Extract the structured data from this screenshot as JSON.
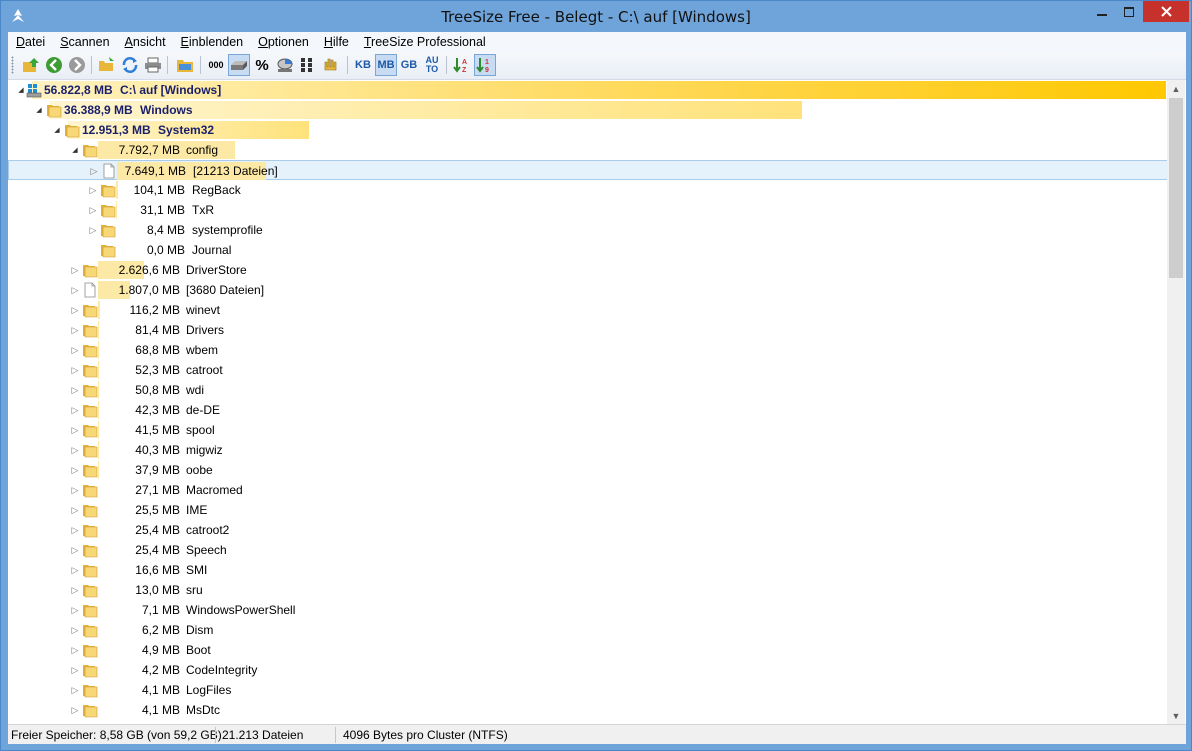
{
  "window": {
    "title": "TreeSize Free - Belegt - C:\\  auf  [Windows]"
  },
  "menu": [
    {
      "label": "Datei",
      "ul": "D",
      "rest": "atei"
    },
    {
      "label": "Scannen",
      "ul": "S",
      "rest": "cannen"
    },
    {
      "label": "Ansicht",
      "ul": "A",
      "rest": "nsicht"
    },
    {
      "label": "Einblenden",
      "ul": "E",
      "rest": "inblenden"
    },
    {
      "label": "Optionen",
      "ul": "O",
      "rest": "ptionen"
    },
    {
      "label": "Hilfe",
      "ul": "H",
      "rest": "ilfe"
    },
    {
      "label": "TreeSize Professional",
      "ul": "T",
      "rest": "reeSize Professional"
    }
  ],
  "toolbar": {
    "kb_label": "KB",
    "mb_label": "MB",
    "gb_label": "GB",
    "auto_label_top": "AU",
    "auto_label_bottom": "TO",
    "percent_label": "%",
    "count_label": "000",
    "active_unit": "MB"
  },
  "tree": [
    {
      "level": 0,
      "size": "56.822,8 MB",
      "name": "C:\\  auf  [Windows]",
      "icon": "drive-icon",
      "expanded": true,
      "bold": true,
      "fraction": 1.0
    },
    {
      "level": 1,
      "size": "36.388,9 MB",
      "name": "Windows",
      "icon": "folder-icon",
      "expanded": true,
      "bold": true,
      "fraction": 0.6404
    },
    {
      "level": 2,
      "size": "12.951,3 MB",
      "name": "System32",
      "icon": "folder-icon",
      "expanded": true,
      "bold": true,
      "fraction": 0.3559
    },
    {
      "level": 3,
      "size": "7.792,7 MB",
      "name": "config",
      "icon": "folder-icon",
      "expanded": true,
      "fraction": 0.6017
    },
    {
      "level": 4,
      "size": "7.649,1 MB",
      "name": "[21213 Dateien]",
      "icon": "file-icon",
      "expander": true,
      "selected": true,
      "fraction": 0.9816
    },
    {
      "level": 4,
      "size": "104,1 MB",
      "name": "RegBack",
      "icon": "folder-icon",
      "expander": true,
      "fraction": 0.0134
    },
    {
      "level": 4,
      "size": "31,1 MB",
      "name": "TxR",
      "icon": "folder-icon",
      "expander": true,
      "fraction": 0.004
    },
    {
      "level": 4,
      "size": "8,4 MB",
      "name": "systemprofile",
      "icon": "folder-icon",
      "expander": true,
      "fraction": 0.0011
    },
    {
      "level": 4,
      "size": "0,0 MB",
      "name": "Journal",
      "icon": "folder-icon",
      "expander": false,
      "fraction": 0.0
    },
    {
      "level": 3,
      "size": "2.626,6 MB",
      "name": "DriverStore",
      "icon": "folder-icon",
      "expander": true,
      "fraction": 0.2028
    },
    {
      "level": 3,
      "size": "1.807,0 MB",
      "name": "[3680 Dateien]",
      "icon": "file-icon",
      "expander": true,
      "fraction": 0.1395
    },
    {
      "level": 3,
      "size": "116,2 MB",
      "name": "winevt",
      "icon": "folder-icon",
      "expander": true,
      "fraction": 0.009
    },
    {
      "level": 3,
      "size": "81,4 MB",
      "name": "Drivers",
      "icon": "folder-icon",
      "expander": true,
      "fraction": 0.0063
    },
    {
      "level": 3,
      "size": "68,8 MB",
      "name": "wbem",
      "icon": "folder-icon",
      "expander": true,
      "fraction": 0.0053
    },
    {
      "level": 3,
      "size": "52,3 MB",
      "name": "catroot",
      "icon": "folder-icon",
      "expander": true,
      "fraction": 0.004
    },
    {
      "level": 3,
      "size": "50,8 MB",
      "name": "wdi",
      "icon": "folder-icon",
      "expander": true,
      "fraction": 0.0039
    },
    {
      "level": 3,
      "size": "42,3 MB",
      "name": "de-DE",
      "icon": "folder-icon",
      "expander": true,
      "fraction": 0.0033
    },
    {
      "level": 3,
      "size": "41,5 MB",
      "name": "spool",
      "icon": "folder-icon",
      "expander": true,
      "fraction": 0.0032
    },
    {
      "level": 3,
      "size": "40,3 MB",
      "name": "migwiz",
      "icon": "folder-icon",
      "expander": true,
      "fraction": 0.0031
    },
    {
      "level": 3,
      "size": "37,9 MB",
      "name": "oobe",
      "icon": "folder-icon",
      "expander": true,
      "fraction": 0.0029
    },
    {
      "level": 3,
      "size": "27,1 MB",
      "name": "Macromed",
      "icon": "folder-icon",
      "expander": true,
      "fraction": 0.0021
    },
    {
      "level": 3,
      "size": "25,5 MB",
      "name": "IME",
      "icon": "folder-icon",
      "expander": true,
      "fraction": 0.002
    },
    {
      "level": 3,
      "size": "25,4 MB",
      "name": "catroot2",
      "icon": "folder-icon",
      "expander": true,
      "fraction": 0.002
    },
    {
      "level": 3,
      "size": "25,4 MB",
      "name": "Speech",
      "icon": "folder-icon",
      "expander": true,
      "fraction": 0.002
    },
    {
      "level": 3,
      "size": "16,6 MB",
      "name": "SMI",
      "icon": "folder-icon",
      "expander": true,
      "fraction": 0.0013
    },
    {
      "level": 3,
      "size": "13,0 MB",
      "name": "sru",
      "icon": "folder-icon",
      "expander": true,
      "fraction": 0.001
    },
    {
      "level": 3,
      "size": "7,1 MB",
      "name": "WindowsPowerShell",
      "icon": "folder-icon",
      "expander": true,
      "fraction": 0.0005
    },
    {
      "level": 3,
      "size": "6,2 MB",
      "name": "Dism",
      "icon": "folder-icon",
      "expander": true,
      "fraction": 0.0005
    },
    {
      "level": 3,
      "size": "4,9 MB",
      "name": "Boot",
      "icon": "folder-icon",
      "expander": true,
      "fraction": 0.0004
    },
    {
      "level": 3,
      "size": "4,2 MB",
      "name": "CodeIntegrity",
      "icon": "folder-icon",
      "expander": true,
      "fraction": 0.0003
    },
    {
      "level": 3,
      "size": "4,1 MB",
      "name": "LogFiles",
      "icon": "folder-icon",
      "expander": true,
      "fraction": 0.0003
    },
    {
      "level": 3,
      "size": "4,1 MB",
      "name": "MsDtc",
      "icon": "folder-icon",
      "expander": true,
      "fraction": 0.0003
    }
  ],
  "status": {
    "free_space": "Freier Speicher: 8,58 GB  (von 59,2 GB)",
    "file_count": "21.213  Dateien",
    "cluster": "4096 Bytes pro Cluster (NTFS)"
  },
  "colors": {
    "title_bg": "#6fa4da",
    "close_bg": "#c7312b",
    "bar_strong": "#ffc800",
    "bar_light": "#fde9a6",
    "selection": "#e5f1fb"
  }
}
